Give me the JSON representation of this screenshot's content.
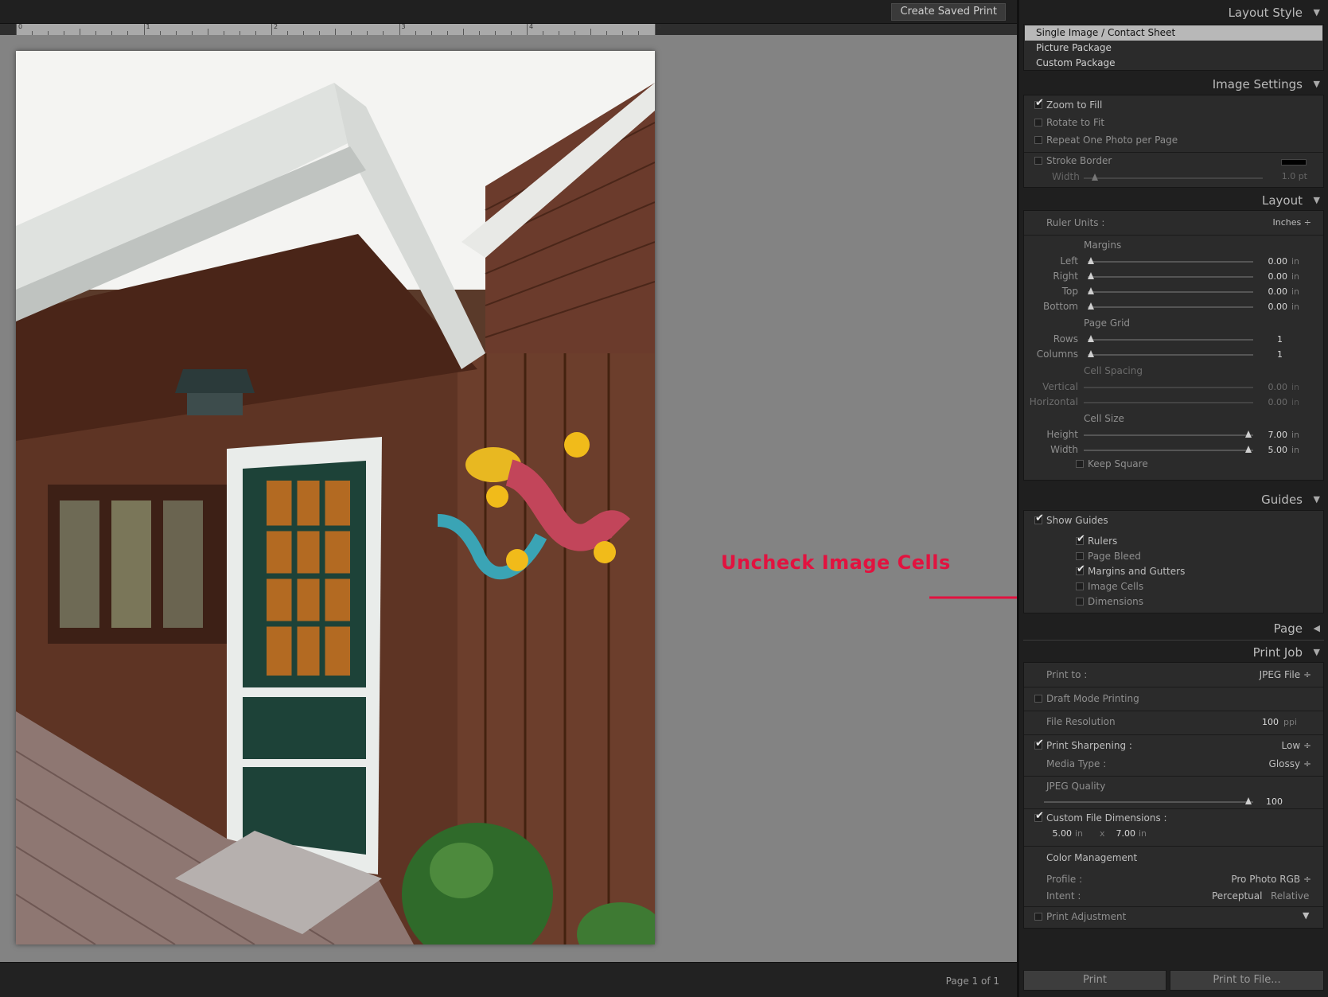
{
  "toolbar": {
    "create_saved_print": "Create Saved Print"
  },
  "ruler": {
    "numbers": [
      "0",
      "1",
      "2",
      "3",
      "4",
      "5"
    ]
  },
  "annotation": {
    "text": "Uncheck Image Cells"
  },
  "status": {
    "page": "Page 1 of 1"
  },
  "layout_style": {
    "title": "Layout Style",
    "items": [
      "Single Image / Contact Sheet",
      "Picture Package",
      "Custom Package"
    ],
    "selected": "Single Image / Contact Sheet"
  },
  "image_settings": {
    "title": "Image Settings",
    "zoom_to_fill": "Zoom to Fill",
    "rotate_to_fit": "Rotate to Fit",
    "repeat_one": "Repeat One Photo per Page",
    "stroke_border": "Stroke Border",
    "width_label": "Width",
    "width_value": "1.0 pt",
    "stroke_color": "#000000"
  },
  "layout": {
    "title": "Layout",
    "ruler_units_label": "Ruler Units :",
    "ruler_units_value": "Inches ÷",
    "margins_heading": "Margins",
    "margins": [
      {
        "label": "Left",
        "value": "0.00",
        "unit": "in"
      },
      {
        "label": "Right",
        "value": "0.00",
        "unit": "in"
      },
      {
        "label": "Top",
        "value": "0.00",
        "unit": "in"
      },
      {
        "label": "Bottom",
        "value": "0.00",
        "unit": "in"
      }
    ],
    "page_grid_heading": "Page Grid",
    "grid": [
      {
        "label": "Rows",
        "value": "1"
      },
      {
        "label": "Columns",
        "value": "1"
      }
    ],
    "cell_spacing_heading": "Cell Spacing",
    "spacing": [
      {
        "label": "Vertical",
        "value": "0.00",
        "unit": "in"
      },
      {
        "label": "Horizontal",
        "value": "0.00",
        "unit": "in"
      }
    ],
    "cell_size_heading": "Cell Size",
    "cell_size": [
      {
        "label": "Height",
        "value": "7.00",
        "unit": "in"
      },
      {
        "label": "Width",
        "value": "5.00",
        "unit": "in"
      }
    ],
    "keep_square": "Keep Square"
  },
  "guides": {
    "title": "Guides",
    "show_guides": "Show Guides",
    "rulers": "Rulers",
    "page_bleed": "Page Bleed",
    "margins_gutters": "Margins and Gutters",
    "image_cells": "Image Cells",
    "dimensions": "Dimensions"
  },
  "page_panel": {
    "title": "Page"
  },
  "print_job": {
    "title": "Print Job",
    "print_to_label": "Print to :",
    "print_to_value": "JPEG File ÷",
    "draft_mode": "Draft Mode Printing",
    "file_resolution_label": "File Resolution",
    "file_resolution_value": "100",
    "file_resolution_unit": "ppi",
    "print_sharpening_label": "Print Sharpening :",
    "print_sharpening_value": "Low ÷",
    "media_type_label": "Media Type :",
    "media_type_value": "Glossy ÷",
    "jpeg_quality_label": "JPEG Quality",
    "jpeg_quality_value": "100",
    "custom_dims_label": "Custom File Dimensions :",
    "dim_w": "5.00",
    "dim_w_unit": "in",
    "dim_x": "x",
    "dim_h": "7.00",
    "dim_h_unit": "in",
    "color_mgmt": "Color Management",
    "profile_label": "Profile :",
    "profile_value": "Pro Photo RGB ÷",
    "intent_label": "Intent :",
    "intent_perceptual": "Perceptual",
    "intent_relative": "Relative",
    "print_adjustment": "Print Adjustment"
  },
  "buttons": {
    "print": "Print",
    "print_to_file": "Print to File..."
  }
}
